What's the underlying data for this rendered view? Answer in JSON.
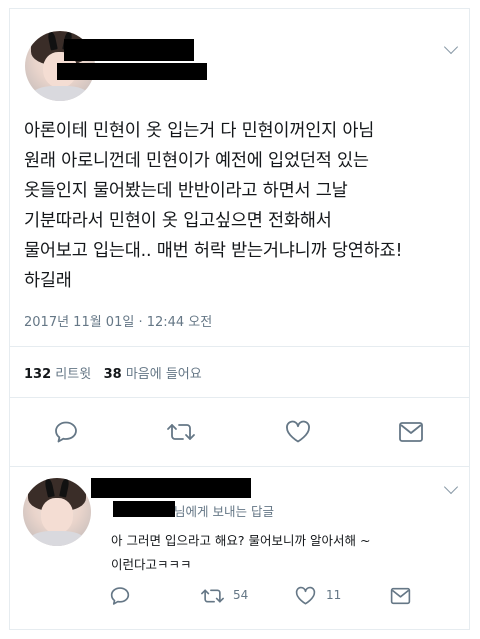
{
  "main_tweet": {
    "text": "아론이테 민현이 옷 입는거 다 민현이꺼인지 아님\n원래 아로니껀데 민현이가 예전에 입었던적 있는\n옷들인지 물어봤는데 반반이라고 하면서 그날\n기분따라서 민현이 옷 입고싶으면 전화해서\n물어보고 입는대.. 매번 허락 받는거냐니까 당연하죠!\n하길래",
    "timestamp": "2017년 11월 01일 · 12:44 오전",
    "retweet_count": "132",
    "retweet_label": "리트윗",
    "like_count": "38",
    "like_label": "마음에 들어요"
  },
  "reply_tweet": {
    "reply_to_label": "님에게 보내는 답글",
    "text": "아 그러면 입으라고 해요? 물어보니까 알아서해 ~\n이런다고ㅋㅋㅋ",
    "retweet_count": "54",
    "like_count": "11"
  },
  "icons": [
    "reply-icon",
    "retweet-icon",
    "like-icon",
    "message-icon",
    "chevron-down-icon"
  ],
  "colors": {
    "text": "#14171a",
    "muted": "#657786",
    "border": "#e6ecf0",
    "icon": "#657786"
  }
}
